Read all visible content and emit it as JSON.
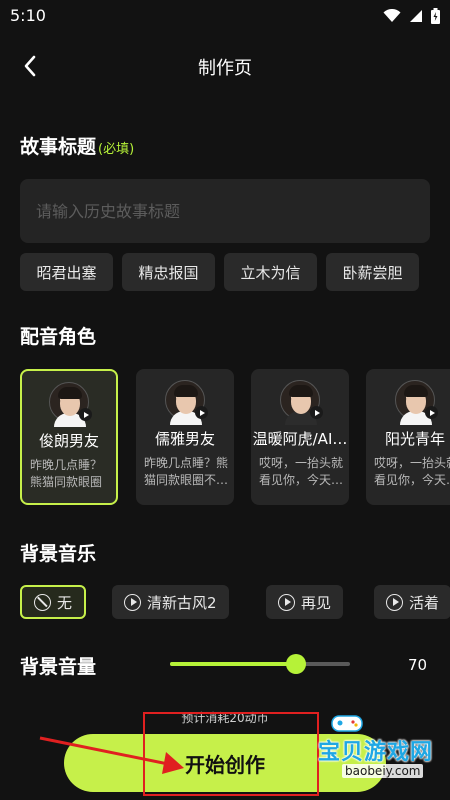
{
  "status": {
    "time": "5:10"
  },
  "header": {
    "title": "制作页"
  },
  "story": {
    "section_title": "故事标题",
    "required_tag": "(必填)",
    "placeholder": "请输入历史故事标题",
    "suggestions": [
      "昭君出塞",
      "精忠报国",
      "立木为信",
      "卧薪尝胆"
    ]
  },
  "voice": {
    "section_title": "配音角色",
    "roles": [
      {
        "name": "俊朗男友",
        "desc": "昨晚几点睡？熊猫同款眼圈不…",
        "selected": true
      },
      {
        "name": "儒雅男友",
        "desc": "昨晚几点睡？熊猫同款眼圈不…",
        "selected": false
      },
      {
        "name": "温暖阿虎/AI…",
        "desc": "哎呀，一抬头就看见你，今天…",
        "selected": false
      },
      {
        "name": "阳光青年",
        "desc": "哎呀，一抬头就看见你，今天…",
        "selected": false
      }
    ]
  },
  "music": {
    "section_title": "背景音乐",
    "options": [
      {
        "label": "无",
        "icon": "none-icon",
        "selected": true
      },
      {
        "label": "清新古风2",
        "icon": "play-icon",
        "selected": false
      },
      {
        "label": "再见",
        "icon": "play-icon",
        "selected": false
      },
      {
        "label": "活着",
        "icon": "play-icon",
        "selected": false
      }
    ]
  },
  "volume": {
    "label": "背景音量",
    "value": 70,
    "value_text": "70"
  },
  "footer": {
    "cost_note": "预计消耗20动币",
    "start_label": "开始创作"
  },
  "watermark": {
    "title": "宝贝游戏网",
    "url": "baobeiy.com"
  },
  "colors": {
    "accent": "#c6f04a",
    "background": "#121212",
    "annotation": "#e02020"
  }
}
